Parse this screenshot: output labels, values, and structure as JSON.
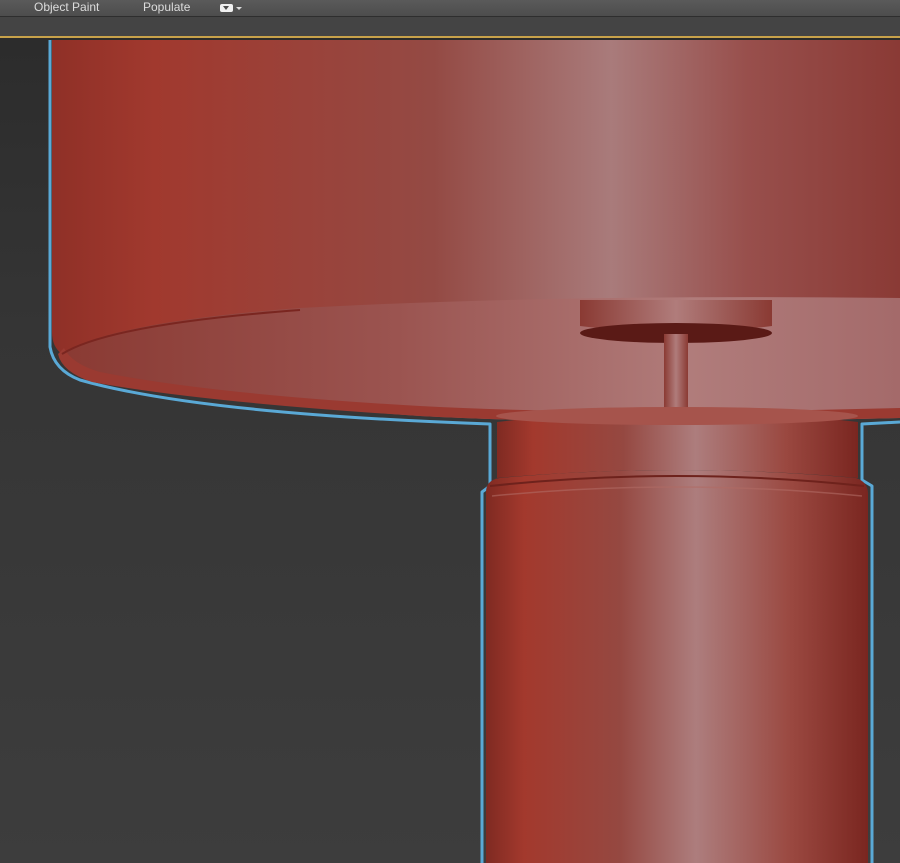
{
  "ribbon": {
    "tabs": [
      {
        "label": "Object Paint"
      },
      {
        "label": "Populate"
      }
    ],
    "dropdown_icon": "ribbon-options-icon"
  },
  "viewport": {
    "border_color": "#c8a24a",
    "selection_outline_color": "#5aa9d6",
    "model": {
      "object": "table-lamp",
      "base_color": "#9b3a30",
      "highlight_color": "#b58080"
    }
  }
}
